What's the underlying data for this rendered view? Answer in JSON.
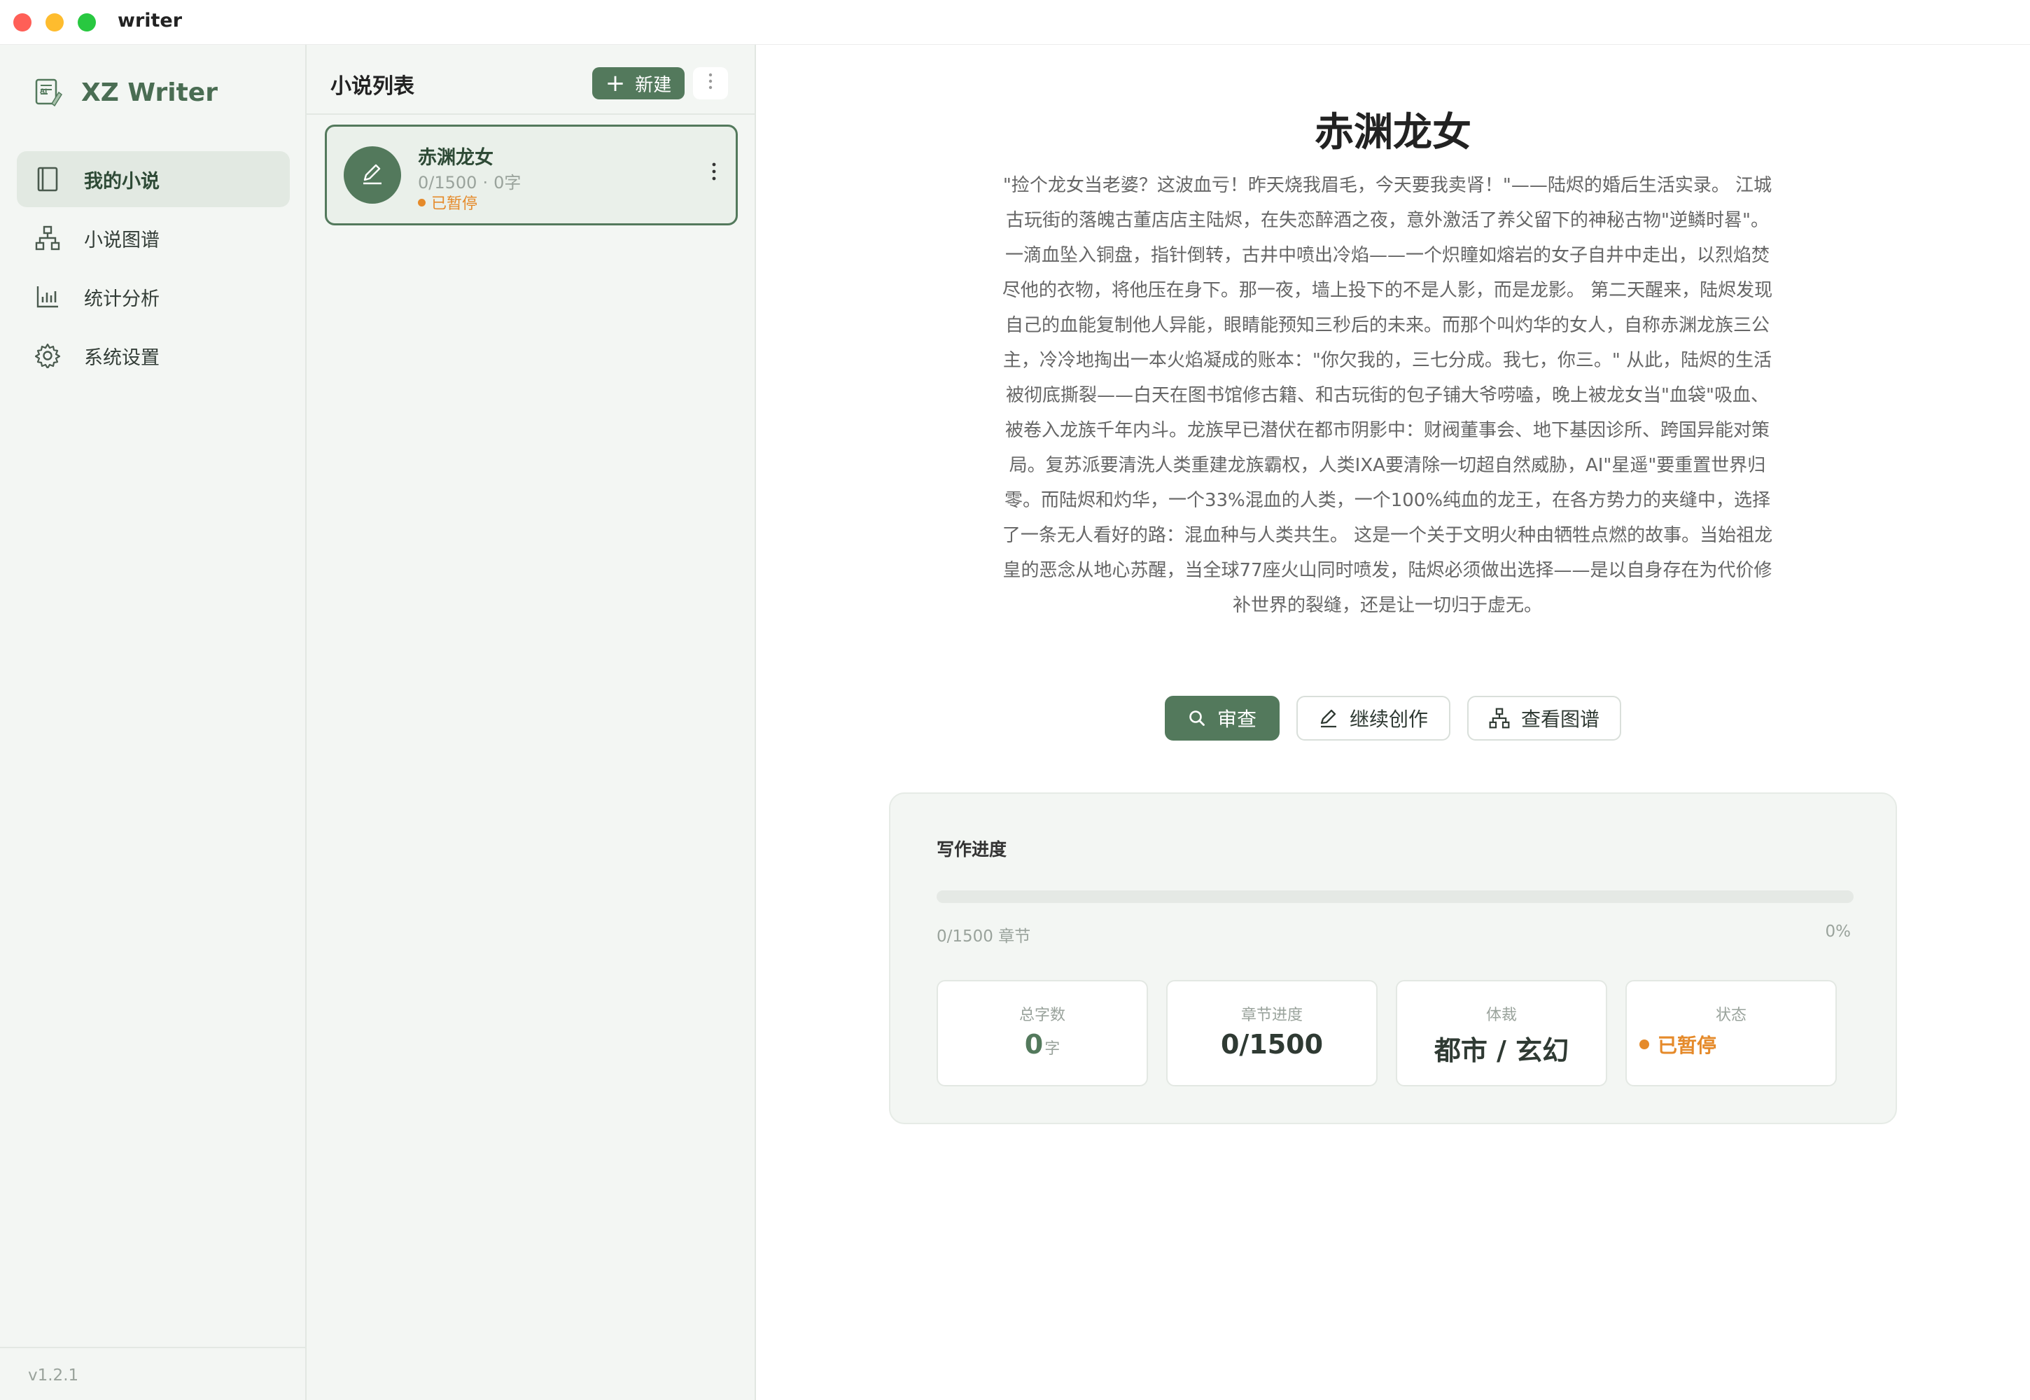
{
  "window": {
    "title": "writer"
  },
  "sidebar": {
    "brand": "XZ Writer",
    "items": [
      {
        "label": "我的小说",
        "icon": "book-icon",
        "active": true
      },
      {
        "label": "小说图谱",
        "icon": "graph-icon",
        "active": false
      },
      {
        "label": "统计分析",
        "icon": "chart-icon",
        "active": false
      },
      {
        "label": "系统设置",
        "icon": "gear-icon",
        "active": false
      }
    ],
    "version": "v1.2.1"
  },
  "list": {
    "title": "小说列表",
    "new_label": "新建",
    "more_icon": "more-vertical-icon",
    "novels": [
      {
        "name": "赤渊龙女",
        "chapters": "0/1500",
        "words": "0字",
        "status": "已暂停",
        "icon": "pen-icon"
      }
    ]
  },
  "main": {
    "title": "赤渊龙女",
    "synopsis": "\"捡个龙女当老婆？这波血亏！昨天烧我眉毛，今天要我卖肾！\"——陆烬的婚后生活实录。 江城古玩街的落魄古董店店主陆烬，在失恋醉酒之夜，意外激活了养父留下的神秘古物\"逆鳞时晷\"。一滴血坠入铜盘，指针倒转，古井中喷出冷焰——一个炽瞳如熔岩的女子自井中走出，以烈焰焚尽他的衣物，将他压在身下。那一夜，墙上投下的不是人影，而是龙影。 第二天醒来，陆烬发现自己的血能复制他人异能，眼睛能预知三秒后的未来。而那个叫灼华的女人，自称赤渊龙族三公主，冷冷地掏出一本火焰凝成的账本：\"你欠我的，三七分成。我七，你三。\" 从此，陆烬的生活被彻底撕裂——白天在图书馆修古籍、和古玩街的包子铺大爷唠嗑，晚上被龙女当\"血袋\"吸血、被卷入龙族千年内斗。龙族早已潜伏在都市阴影中：财阀董事会、地下基因诊所、跨国异能对策局。复苏派要清洗人类重建龙族霸权，人类IXA要清除一切超自然威胁，AI\"星遥\"要重置世界归零。而陆烬和灼华，一个33%混血的人类，一个100%纯血的龙王，在各方势力的夹缝中，选择了一条无人看好的路：混血种与人类共生。 这是一个关于文明火种由牺牲点燃的故事。当始祖龙皇的恶念从地心苏醒，当全球77座火山同时喷发，陆烬必须做出选择——是以自身存在为代价修补世界的裂缝，还是让一切归于虚无。",
    "actions": {
      "review": "审查",
      "continue": "继续创作",
      "graph": "查看图谱"
    },
    "progress": {
      "title": "写作进度",
      "chapters_text": "0/1500 章节",
      "percent_text": "0%",
      "fraction": 0
    },
    "stats": {
      "words_label": "总字数",
      "words_value": "0",
      "words_unit": "字",
      "chapters_label": "章节进度",
      "chapters_value": "0/1500",
      "genre_label": "体裁",
      "genre_value": "都市 / 玄幻",
      "status_label": "状态",
      "status_value": "已暂停"
    }
  },
  "colors": {
    "accent": "#53795c",
    "paused": "#e58a2a"
  }
}
